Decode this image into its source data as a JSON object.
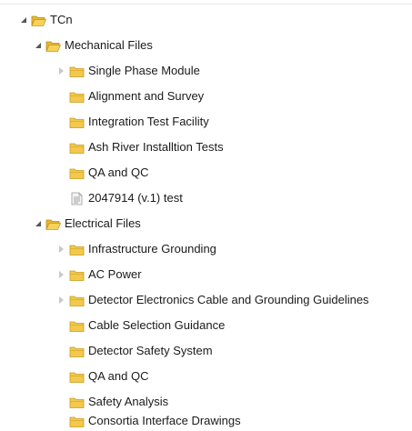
{
  "tree": {
    "root": {
      "label": "TCn",
      "icon": "folder-open-icon"
    },
    "mechanical": {
      "label": "Mechanical Files",
      "icon": "folder-open-icon",
      "children": [
        {
          "label": "Single Phase Module",
          "icon": "folder-icon",
          "expandable": true
        },
        {
          "label": "Alignment and Survey",
          "icon": "folder-icon",
          "expandable": false
        },
        {
          "label": "Integration Test Facility",
          "icon": "folder-icon",
          "expandable": false
        },
        {
          "label": "Ash River Installtion Tests",
          "icon": "folder-icon",
          "expandable": false
        },
        {
          "label": "QA and QC",
          "icon": "folder-icon",
          "expandable": false
        },
        {
          "label": "2047914 (v.1) test",
          "icon": "document-icon",
          "expandable": false
        }
      ]
    },
    "electrical": {
      "label": "Electrical Files",
      "icon": "folder-open-icon",
      "children": [
        {
          "label": "Infrastructure Grounding",
          "icon": "folder-icon",
          "expandable": true
        },
        {
          "label": "AC Power",
          "icon": "folder-icon",
          "expandable": true
        },
        {
          "label": "Detector Electronics Cable and Grounding Guidelines",
          "icon": "folder-icon",
          "expandable": true
        },
        {
          "label": "Cable Selection Guidance",
          "icon": "folder-icon",
          "expandable": false
        },
        {
          "label": "Detector Safety System",
          "icon": "folder-icon",
          "expandable": false
        },
        {
          "label": "QA and QC",
          "icon": "folder-icon",
          "expandable": false
        },
        {
          "label": "Safety Analysis",
          "icon": "folder-icon",
          "expandable": false
        },
        {
          "label": "Consortia Interface Drawings",
          "icon": "folder-icon",
          "expandable": false
        }
      ]
    }
  },
  "colors": {
    "folder_fill": "#f2c94c",
    "folder_stroke": "#c99a1e",
    "expander_expanded": "#555555",
    "expander_collapsed": "#c8c8c8"
  }
}
